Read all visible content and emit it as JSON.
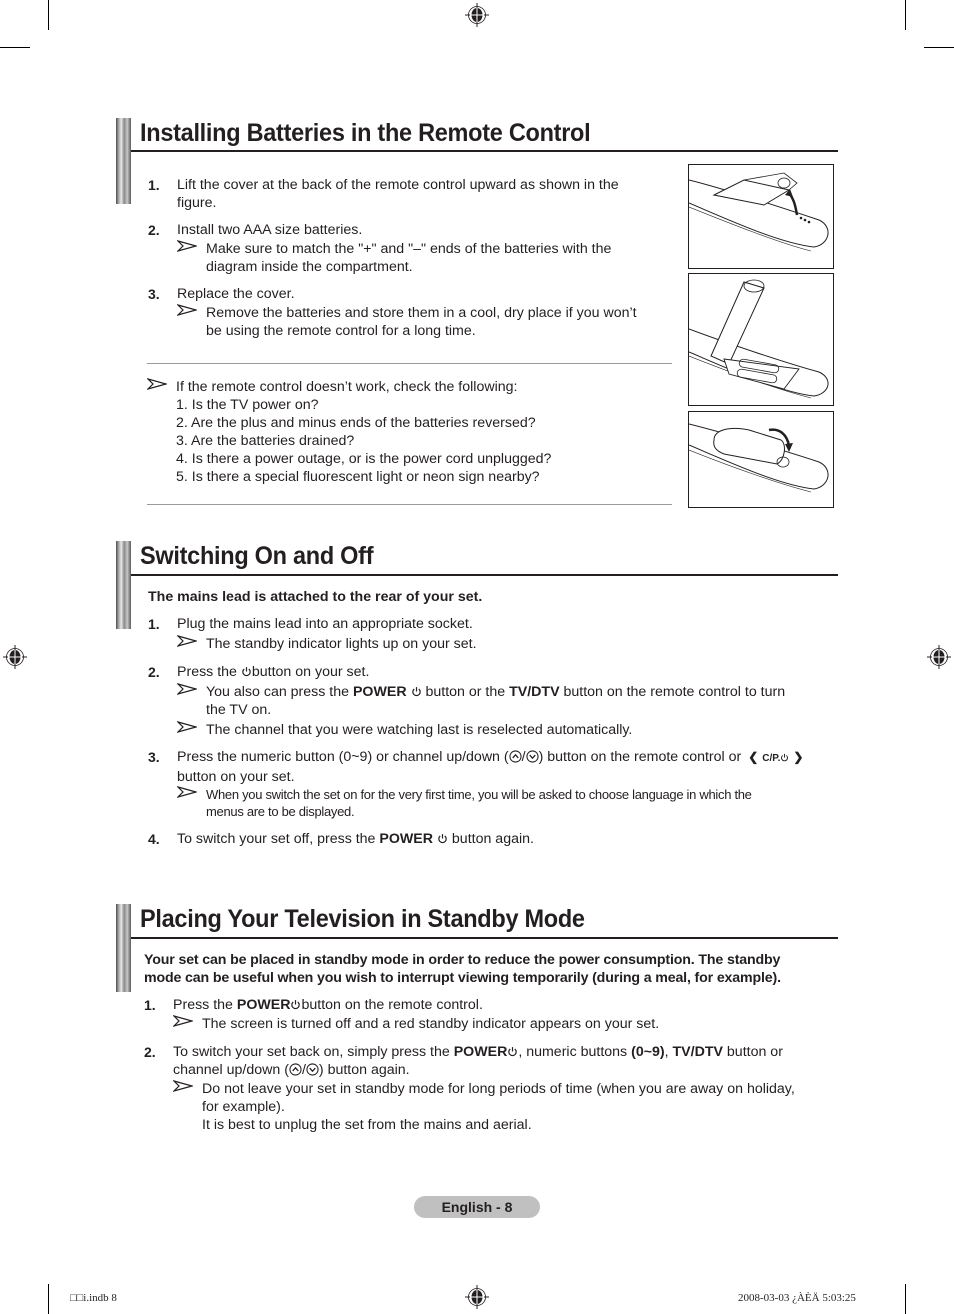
{
  "page": {
    "footer_label": "English - 8",
    "slug_left": "□□i.indb   8",
    "slug_right": "2008-03-03   ¿ÀÈÄ 5:03:25"
  },
  "sections": [
    {
      "title": "Installing Batteries in the Remote Control",
      "steps": [
        {
          "num": "1.",
          "text_l1": "Lift the cover at the back of the remote control upward as shown in the",
          "text_l2": "figure."
        },
        {
          "num": "2.",
          "text": "Install two AAA size batteries.",
          "note_l1": "Make sure to match the \"+\" and \"–\" ends of the batteries with the",
          "note_l2": "diagram inside the compartment."
        },
        {
          "num": "3.",
          "text": "Replace the cover.",
          "note_l1": "Remove the batteries and store them in a cool, dry place if you won’t",
          "note_l2": "be using the remote control for a long time."
        }
      ],
      "check_intro": "If the remote control doesn’t work, check the following:",
      "checks": [
        "1. Is the TV power on?",
        "2. Are the plus and minus ends of the batteries reversed?",
        "3. Are the batteries drained?",
        "4. Is there a power outage, or is the power cord unplugged?",
        "5. Is there a special fluorescent light or neon sign nearby?"
      ],
      "figures": [
        "remote-cover-lift-figure",
        "remote-batteries-installed-figure",
        "remote-cover-replace-figure"
      ]
    },
    {
      "title": "Switching On and Off",
      "intro": "The mains lead is attached to the rear of your set.",
      "s1": {
        "num": "1.",
        "text": "Plug the mains lead into an appropriate socket.",
        "note": "The standby indicator lights up on your set."
      },
      "s2": {
        "num": "2.",
        "pre": "Press the ",
        "post": "button on your set.",
        "n1_pre": "You also can press the ",
        "n1_b1": "POWER",
        "n1_mid": " button or the ",
        "n1_b2": "TV/DTV",
        "n1_post": " button on the remote control to turn",
        "n1_l2": "the TV on.",
        "n2": "The channel that you were watching last is reselected automatically."
      },
      "s3": {
        "num": "3.",
        "pre": "Press the numeric button (0~9) or channel up/down (",
        "mid": "/",
        "post": ") button on the remote control or",
        "cp_label": "C/P.",
        "l2": "button on your set.",
        "note_l1": "When you switch the set on for the very first time, you will be asked to choose language in which the",
        "note_l2": "menus are to be displayed."
      },
      "s4": {
        "num": "4.",
        "pre": "To switch your set off, press the ",
        "bold": "POWER",
        "post": " button again."
      }
    },
    {
      "title": "Placing Your Television in Standby Mode",
      "intro_l1": "Your set can be placed in standby mode in order to reduce the power consumption. The standby",
      "intro_l2": "mode can be useful when you wish to interrupt viewing temporarily (during a meal, for example).",
      "s1": {
        "num": "1.",
        "pre": "Press the ",
        "bold": "POWER",
        "post": "button on the remote control.",
        "note": "The screen is turned off and a red standby indicator appears on your set."
      },
      "s2": {
        "num": "2.",
        "pre": "To switch your set back on, simply press the ",
        "b1": "POWER",
        "mid1": ", numeric buttons ",
        "b2": "(0~9)",
        "mid2": ", ",
        "b3": "TV/DTV",
        "post": " button or",
        "l2_pre": "channel up/down (",
        "l2_mid": "/",
        "l2_post": ") button again.",
        "note_l1": "Do not leave your set in standby mode for long periods of time (when you are away on holiday,",
        "note_l2": "for example).",
        "note_l3": "It is best to unplug the set from the mains and aerial."
      }
    }
  ]
}
